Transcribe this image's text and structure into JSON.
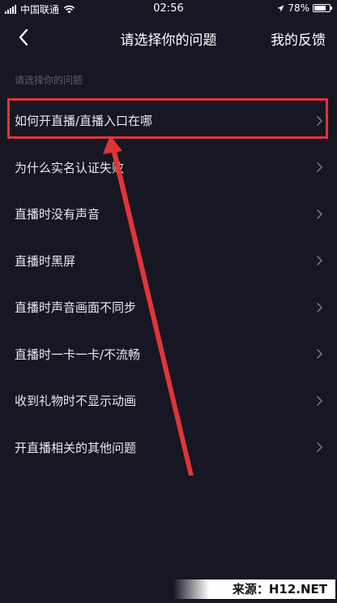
{
  "status_bar": {
    "carrier": "中国联通",
    "time": "02:56",
    "battery_percent": "78%",
    "battery_level": 0.78,
    "icons": [
      "signal-icon",
      "wifi-icon",
      "location-icon",
      "battery-icon"
    ]
  },
  "nav": {
    "title": "请选择你的问题",
    "action": "我的反馈",
    "back_icon": "chevron-left-icon"
  },
  "section_header": "请选择你的问题",
  "items": [
    {
      "label": "如何开直播/直播入口在哪"
    },
    {
      "label": "为什么实名认证失败"
    },
    {
      "label": "直播时没有声音"
    },
    {
      "label": "直播时黑屏"
    },
    {
      "label": "直播时声音画面不同步"
    },
    {
      "label": "直播时一卡一卡/不流畅"
    },
    {
      "label": "收到礼物时不显示动画"
    },
    {
      "label": "开直播相关的其他问题"
    }
  ],
  "colors": {
    "background": "#161722",
    "annotation": "#e03537",
    "muted_text": "#5d5e68"
  },
  "watermark": "来源：H12.NET"
}
